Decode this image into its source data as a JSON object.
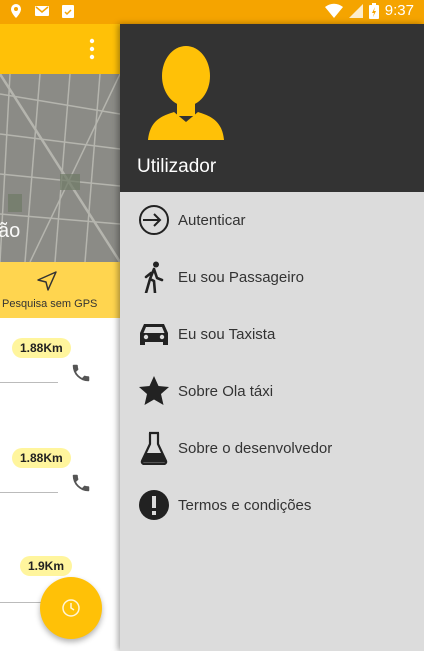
{
  "status_bar": {
    "time": "9:37",
    "icons": [
      "location-pin-icon",
      "gmail-icon",
      "clipboard-check-icon",
      "wifi-icon",
      "signal-icon",
      "battery-icon"
    ]
  },
  "background_app": {
    "map_label": "ão",
    "gps_button": {
      "label": "Pesquisa sem GPS",
      "icon": "send-arrow-icon"
    },
    "results": [
      {
        "distance": "1.88Km"
      },
      {
        "distance": "1.88Km"
      },
      {
        "distance": "1.9Km"
      }
    ],
    "fab_icon": "refresh-icon"
  },
  "drawer": {
    "header": {
      "username": "Utilizador",
      "avatar_icon": "person-avatar-icon"
    },
    "items": [
      {
        "label": "Autenticar",
        "icon": "login-icon"
      },
      {
        "label": "Eu sou Passageiro",
        "icon": "walk-icon"
      },
      {
        "label": "Eu sou Taxista",
        "icon": "car-icon"
      },
      {
        "label": "Sobre Ola táxi",
        "icon": "star-icon"
      },
      {
        "label": "Sobre o desenvolvedor",
        "icon": "flask-icon"
      },
      {
        "label": "Termos e condições",
        "icon": "info-icon"
      }
    ]
  },
  "colors": {
    "status_bar": "#f5a400",
    "toolbar": "#ffc107",
    "gps_bar": "#ffd54f",
    "distance_badge": "#fff59d",
    "drawer_header": "#333333",
    "drawer_body": "#dcdcdc",
    "avatar": "#ffc107"
  }
}
